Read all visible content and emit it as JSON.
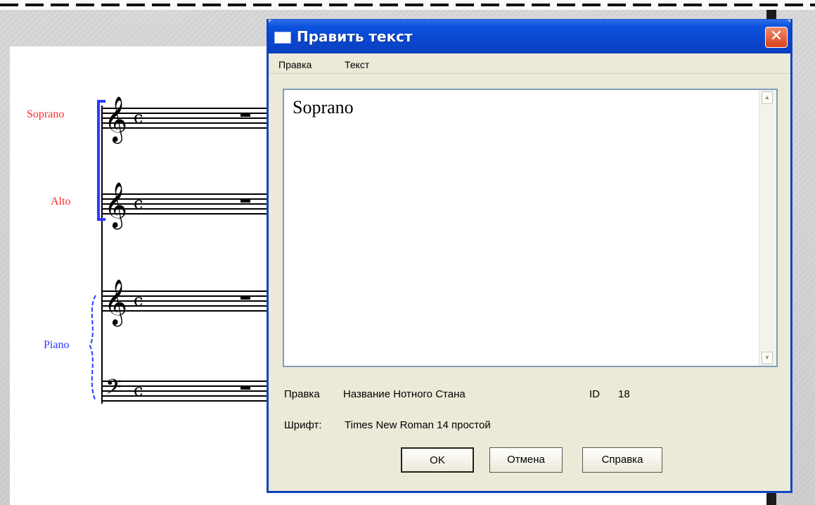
{
  "score": {
    "staff_labels": {
      "soprano": "Soprano",
      "alto": "Alto",
      "piano": "Piano"
    }
  },
  "dialog": {
    "title": "Править текст",
    "close_glyph": "✕",
    "menu": [
      "Правка",
      "Текст"
    ],
    "text_value": "Soprano",
    "info": {
      "edit_label": "Правка",
      "edit_value": "Название Нотного Стана",
      "id_label": "ID",
      "id_value": "18",
      "font_label": "Шрифт:",
      "font_value": "Times New Roman 14 простой"
    },
    "buttons": {
      "ok": "OK",
      "cancel": "Отмена",
      "help": "Справка"
    }
  },
  "icons": {
    "close": "close-icon",
    "window": "window-icon",
    "scroll_up": "scroll-up-icon",
    "scroll_down": "scroll-down-icon",
    "treble_clef": "treble-clef-icon",
    "bass_clef": "bass-clef-icon"
  },
  "colors": {
    "titlebar": "#0b52dd",
    "soprano_label": "#ff2b2b",
    "piano_label": "#2a3bff",
    "dialog_bg": "#ece9d8"
  }
}
